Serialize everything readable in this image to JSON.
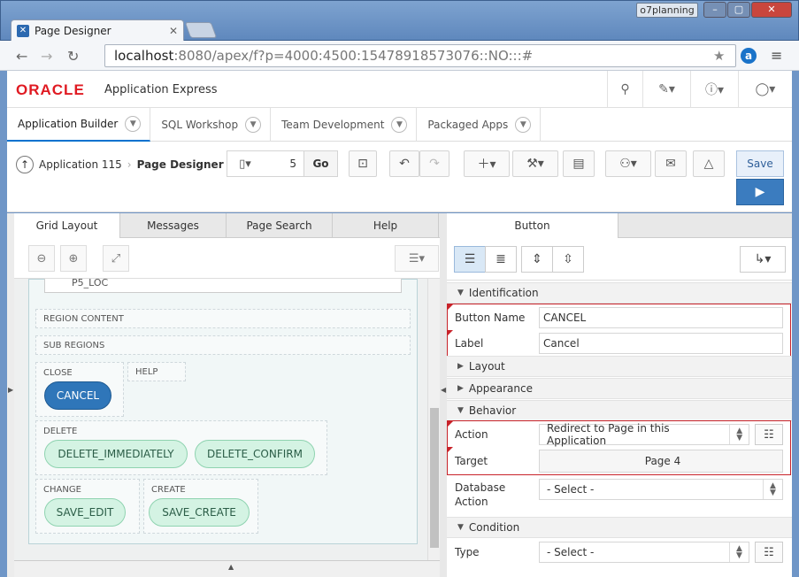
{
  "browser": {
    "tab_title": "Page Designer",
    "profile": "o7planning",
    "url_host": "localhost",
    "url_rest": ":8080/apex/f?p=4000:4500:15478918573076::NO:::#"
  },
  "apex": {
    "logo": "ORACLE",
    "product": "Application Express"
  },
  "nav_tabs": [
    {
      "label": "Application Builder"
    },
    {
      "label": "SQL Workshop"
    },
    {
      "label": "Team Development"
    },
    {
      "label": "Packaged Apps"
    }
  ],
  "toolbar": {
    "crumb_app": "Application 115",
    "crumb_page": "Page Designer",
    "page_number": "5",
    "go_label": "Go",
    "save_label": "Save"
  },
  "left_tabs": [
    {
      "label": "Grid Layout"
    },
    {
      "label": "Messages"
    },
    {
      "label": "Page Search"
    },
    {
      "label": "Help"
    }
  ],
  "grid": {
    "top_field": "P5_LOC",
    "region_content": "REGION CONTENT",
    "sub_regions": "SUB REGIONS",
    "close_label": "CLOSE",
    "help_label": "HELP",
    "cancel_btn": "CANCEL",
    "delete_label": "DELETE",
    "delete_immediately": "DELETE_IMMEDIATELY",
    "delete_confirm": "DELETE_CONFIRM",
    "change_label": "CHANGE",
    "create_label": "CREATE",
    "save_edit": "SAVE_EDIT",
    "save_create": "SAVE_CREATE"
  },
  "right": {
    "tab": "Button",
    "sections": {
      "identification": "Identification",
      "layout": "Layout",
      "appearance": "Appearance",
      "behavior": "Behavior",
      "condition": "Condition"
    },
    "button_name_label": "Button Name",
    "button_name": "CANCEL",
    "label_label": "Label",
    "label": "Cancel",
    "action_label": "Action",
    "action": "Redirect to Page in this Application",
    "target_label": "Target",
    "target": "Page 4",
    "db_action_label_1": "Database",
    "db_action_label_2": "Action",
    "db_action": "- Select -",
    "type_label": "Type",
    "type": "- Select -"
  },
  "colors": {
    "accent": "#0572ce",
    "oracle_red": "#e01a22",
    "selected_button": "#2f76b9",
    "required_flag": "#c8232a"
  }
}
